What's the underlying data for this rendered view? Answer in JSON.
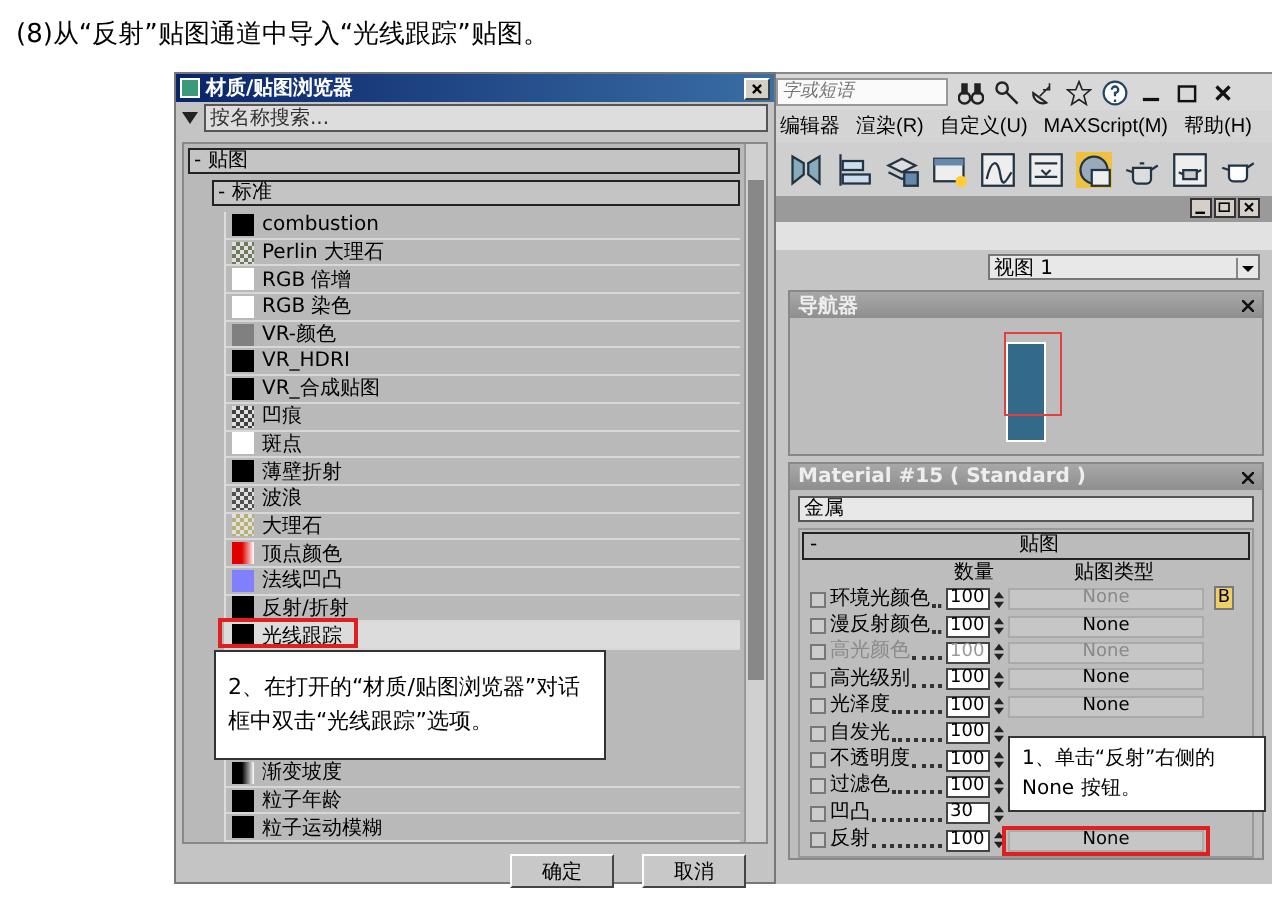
{
  "heading": "(8)从“反射”贴图通道中导入“光线跟踪”贴图。",
  "browser": {
    "title": "材质/贴图浏览器",
    "search": {
      "placeholder": "按名称搜索..."
    },
    "group": "- 贴图",
    "subgroup": "- 标准",
    "items": [
      {
        "label": "combustion",
        "color": "#000000",
        "kind": "solid",
        "selected": false
      },
      {
        "label": "Perlin 大理石",
        "color": "#6f7a5a",
        "kind": "noise",
        "selected": false
      },
      {
        "label": "RGB 倍增",
        "color": "#ffffff",
        "kind": "solid",
        "selected": false
      },
      {
        "label": "RGB 染色",
        "color": "#ffffff",
        "kind": "solid",
        "selected": false
      },
      {
        "label": "VR-颜色",
        "color": "#808080",
        "kind": "solid",
        "selected": false
      },
      {
        "label": "VR_HDRI",
        "color": "#000000",
        "kind": "solid",
        "selected": false
      },
      {
        "label": "VR_合成贴图",
        "color": "#000000",
        "kind": "solid",
        "selected": false
      },
      {
        "label": "凹痕",
        "color": "#404040",
        "kind": "noise",
        "selected": false
      },
      {
        "label": "斑点",
        "color": "#ffffff",
        "kind": "solid",
        "selected": false
      },
      {
        "label": "薄壁折射",
        "color": "#000000",
        "kind": "solid",
        "selected": false
      },
      {
        "label": "波浪",
        "color": "#505050",
        "kind": "noise",
        "selected": false
      },
      {
        "label": "大理石",
        "color": "#b8b070",
        "kind": "noise",
        "selected": false
      },
      {
        "label": "顶点颜色",
        "color": "#e00000",
        "kind": "gradient",
        "selected": false
      },
      {
        "label": "法线凹凸",
        "color": "#8080ff",
        "kind": "solid",
        "selected": false
      },
      {
        "label": "反射/折射",
        "color": "#000000",
        "kind": "solid",
        "selected": false
      },
      {
        "label": "光线跟踪",
        "color": "#000000",
        "kind": "solid",
        "selected": true,
        "highlighted": true
      }
    ],
    "callout": "2、在打开的“材质/贴图浏览器”对话框中双击“光线跟踪”选项。",
    "more_items": [
      {
        "label": "渐变坡度",
        "color": "#000000",
        "kind": "gradient",
        "selected": false
      },
      {
        "label": "粒子年龄",
        "color": "#000000",
        "kind": "solid",
        "selected": false
      },
      {
        "label": "粒子运动模糊",
        "color": "#000000",
        "kind": "solid",
        "selected": false
      }
    ],
    "buttons": [
      "确定",
      "取消"
    ]
  },
  "app": {
    "search": {
      "placeholder": "字或短语"
    },
    "menu": [
      "编辑器",
      "渲染(R)",
      "自定义(U)",
      "MAXScript(M)",
      "帮助(H)"
    ],
    "view_select": "视图 1",
    "navigator": {
      "title": "导航器"
    },
    "material": {
      "title": "Material #15  ( Standard )",
      "name": "金属",
      "rollout_toggle": "-",
      "rollout": "贴图",
      "columns": [
        "数量",
        "贴图类型"
      ],
      "lock_badge": "B",
      "maps": [
        {
          "label": "环境光颜色",
          "amount": "100",
          "map": "None",
          "checked": false,
          "disabled": false,
          "map_disabled": true,
          "highlighted": false
        },
        {
          "label": "漫反射颜色",
          "amount": "100",
          "map": "None",
          "checked": false,
          "disabled": false,
          "map_disabled": false,
          "highlighted": false
        },
        {
          "label": "高光颜色",
          "amount": "100",
          "map": "None",
          "checked": false,
          "disabled": true,
          "map_disabled": true,
          "highlighted": false
        },
        {
          "label": "高光级别",
          "amount": "100",
          "map": "None",
          "checked": false,
          "disabled": false,
          "map_disabled": false,
          "highlighted": false
        },
        {
          "label": "光泽度",
          "amount": "100",
          "map": "None",
          "checked": false,
          "disabled": false,
          "map_disabled": false,
          "highlighted": false
        },
        {
          "label": "自发光",
          "amount": "100",
          "checked": false,
          "disabled": false,
          "highlighted": false
        },
        {
          "label": "不透明度",
          "amount": "100",
          "checked": false,
          "disabled": false,
          "highlighted": false
        },
        {
          "label": "过滤色",
          "amount": "100",
          "checked": false,
          "disabled": false,
          "highlighted": false
        },
        {
          "label": "凹凸",
          "amount": "30",
          "checked": false,
          "disabled": false,
          "highlighted": false
        },
        {
          "label": "反射",
          "amount": "100",
          "map": "None",
          "checked": false,
          "disabled": false,
          "map_disabled": false,
          "highlighted": true
        }
      ]
    },
    "callout": "1、单击“反射”右侧的 None 按钮。"
  }
}
